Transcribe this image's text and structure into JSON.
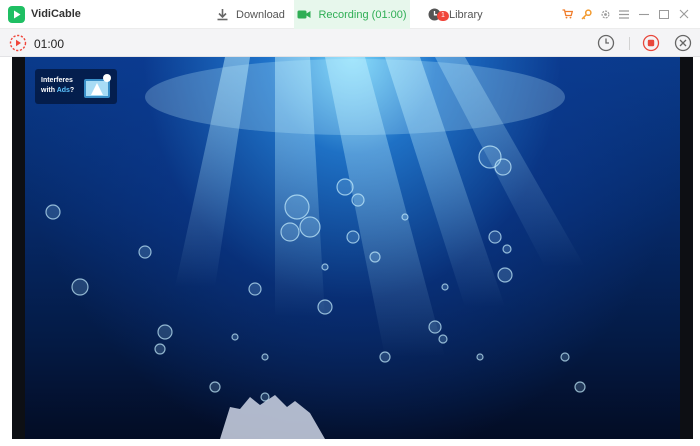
{
  "app": {
    "title": "VidiCable"
  },
  "tabs": [
    {
      "label": "Download",
      "icon": "download-icon"
    },
    {
      "label": "Recording (01:00)",
      "icon": "video-camera-icon",
      "active": true
    },
    {
      "label": "Library",
      "icon": "clock-icon",
      "badge": "1"
    }
  ],
  "recording": {
    "timer": "01:00"
  },
  "ad_overlay": {
    "line1": "Interferes",
    "line2_prefix": "with ",
    "line2_highlight": "Ads",
    "line2_suffix": "?"
  },
  "colors": {
    "accent": "#2fae55",
    "accent_bg": "#e7f7ec",
    "stop_red": "#e8473c",
    "badge_red": "#f0463b",
    "cart_orange": "#f07c2a",
    "key_orange": "#f29a2e",
    "ad_highlight": "#5dc4ff"
  },
  "window_controls": [
    "cart-icon",
    "key-icon",
    "gear-icon",
    "menu-icon",
    "minimize-icon",
    "maximize-icon",
    "close-icon"
  ]
}
